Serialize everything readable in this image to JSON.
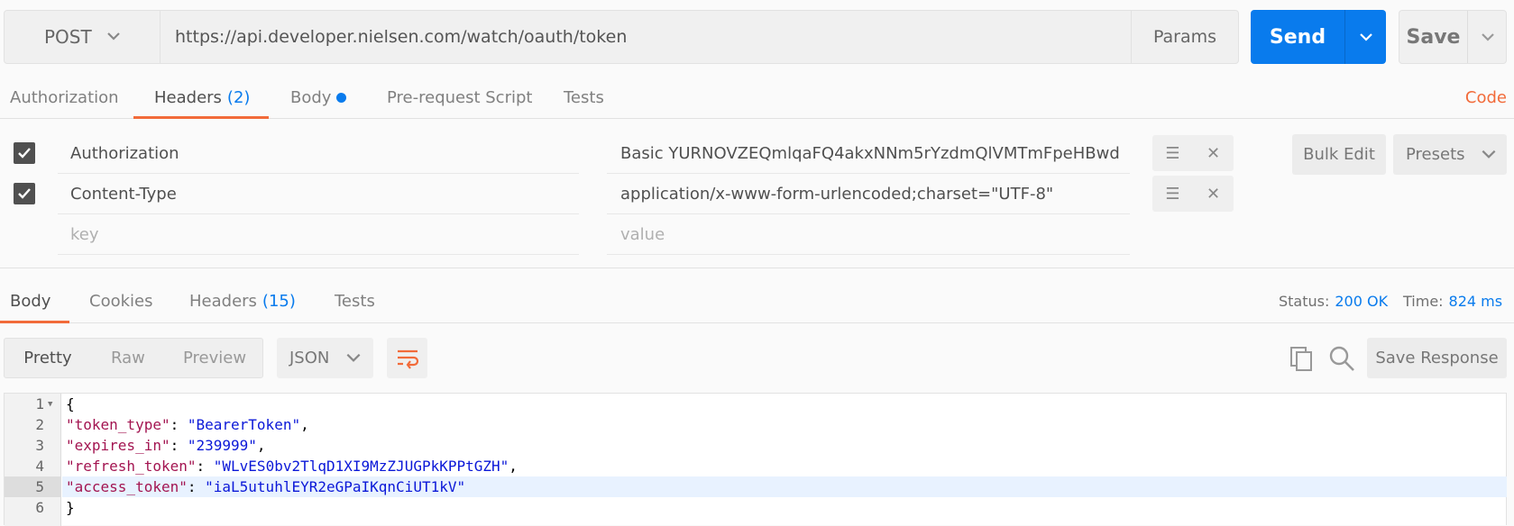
{
  "request": {
    "method": "POST",
    "url": "https://api.developer.nielsen.com/watch/oauth/token",
    "params_label": "Params",
    "send_label": "Send",
    "save_label": "Save"
  },
  "request_tabs": [
    {
      "label": "Authorization"
    },
    {
      "label": "Headers",
      "count": "(2)"
    },
    {
      "label": "Body"
    },
    {
      "label": "Pre-request Script"
    },
    {
      "label": "Tests"
    }
  ],
  "code_link": "Code",
  "headers": [
    {
      "key": "Authorization",
      "value": "Basic YURNOVZEQmlqaFQ4akxNNm5rYzdmQlVMTmFpeHBwd",
      "checked": true
    },
    {
      "key": "Content-Type",
      "value": "application/x-www-form-urlencoded;charset=\"UTF-8\"",
      "checked": true
    }
  ],
  "new_header": {
    "key_placeholder": "key",
    "value_placeholder": "value"
  },
  "bulk_edit_label": "Bulk Edit",
  "presets_label": "Presets",
  "response_tabs": [
    {
      "label": "Body"
    },
    {
      "label": "Cookies"
    },
    {
      "label": "Headers",
      "count": "(15)"
    },
    {
      "label": "Tests"
    }
  ],
  "response_status": {
    "status_label": "Status:",
    "status_value": "200 OK",
    "time_label": "Time:",
    "time_value": "824 ms"
  },
  "view_modes": [
    "Pretty",
    "Raw",
    "Preview"
  ],
  "format": "JSON",
  "save_response_label": "Save Response",
  "body_lines": {
    "l1": "{",
    "l2_key": "\"token_type\"",
    "l2_val": "\"BearerToken\"",
    "l3_key": "\"expires_in\"",
    "l3_val": "\"239999\"",
    "l4_key": "\"refresh_token\"",
    "l4_val": "\"WLvES0bv2TlqD1XI9MzZJUGPkKPPtGZH\"",
    "l5_key": "\"access_token\"",
    "l5_val": "\"iaL5utuhlEYR2eGPaIKqnCiUT1kV\"",
    "l6": "}"
  },
  "line_numbers": [
    "1",
    "2",
    "3",
    "4",
    "5",
    "6"
  ],
  "colors": {
    "accent": "#097bed",
    "tab_underline": "#f26b3a",
    "json_key": "#a31551",
    "json_string": "#0b18d8"
  }
}
